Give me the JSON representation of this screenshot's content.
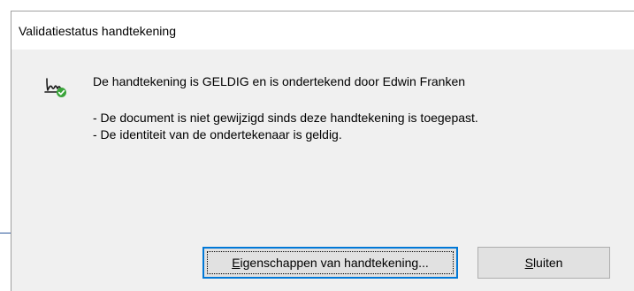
{
  "dialog": {
    "title": "Validatiestatus handtekening",
    "message": "De handtekening is GELDIG en is ondertekend door Edwin Franken",
    "details": [
      "- De document is niet gewijzigd sinds deze handtekening is toegepast.",
      "- De identiteit van de ondertekenaar is geldig."
    ],
    "icon": "signature-valid-icon"
  },
  "buttons": {
    "properties": {
      "mnemonic": "E",
      "label_rest": "igenschappen van handtekening..."
    },
    "close": {
      "mnemonic": "S",
      "label_rest": "luiten"
    }
  },
  "colors": {
    "focus_border": "#0078d7",
    "valid_check": "#3aa43a"
  }
}
